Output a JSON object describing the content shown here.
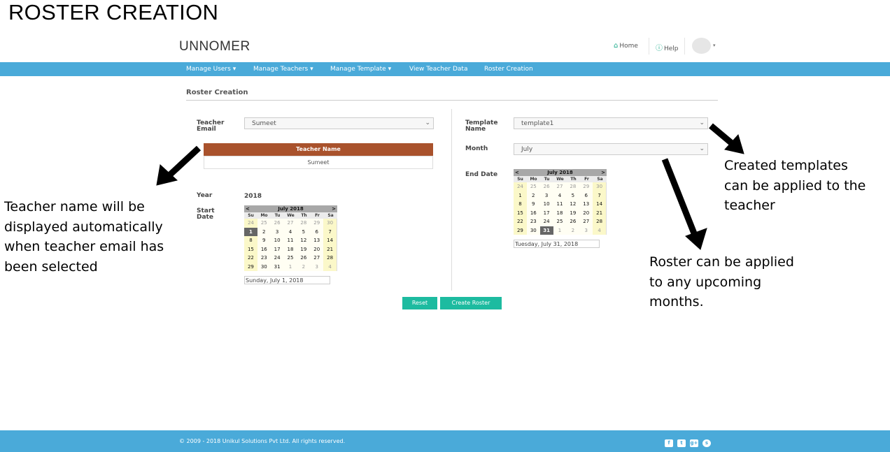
{
  "heading": "ROSTER CREATION",
  "header": {
    "brand": "UNNOMER",
    "home_label": "Home",
    "help_label": "Help"
  },
  "nav": {
    "items": [
      "Manage Users",
      "Manage Teachers",
      "Manage Template",
      "View Teacher Data",
      "Roster Creation"
    ]
  },
  "form": {
    "section_title": "Roster Creation",
    "teacher_email_label_1": "Teacher",
    "teacher_email_label_2": "Email",
    "teacher_email_value": "Sumeet",
    "teacher_name_header": "Teacher Name",
    "teacher_name_value": "Sumeet",
    "year_label": "Year",
    "year_value": "2018",
    "start_date_label_1": "Start",
    "start_date_label_2": "Date",
    "start_date_value": "Sunday, July 1, 2018",
    "template_label_1": "Template",
    "template_label_2": "Name",
    "template_value": "template1",
    "month_label": "Month",
    "month_value": "July",
    "end_date_label": "End Date",
    "end_date_value": "Tuesday, July 31, 2018",
    "reset_label": "Reset",
    "create_label": "Create Roster"
  },
  "calendar": {
    "title": "July 2018",
    "prev": "<",
    "next": ">",
    "weekdays": [
      "Su",
      "Mo",
      "Tu",
      "We",
      "Th",
      "Fr",
      "Sa"
    ],
    "days": [
      "24",
      "25",
      "26",
      "27",
      "28",
      "29",
      "30",
      "1",
      "2",
      "3",
      "4",
      "5",
      "6",
      "7",
      "8",
      "9",
      "10",
      "11",
      "12",
      "13",
      "14",
      "15",
      "16",
      "17",
      "18",
      "19",
      "20",
      "21",
      "22",
      "23",
      "24",
      "25",
      "26",
      "27",
      "28",
      "29",
      "30",
      "31",
      "1",
      "2",
      "3",
      "4"
    ],
    "start_selected": "1",
    "end_selected": "31"
  },
  "annotations": {
    "teacher_name": [
      "Teacher name will be",
      "displayed automatically",
      "when teacher email has",
      "been selected"
    ],
    "templates": [
      "Created templates",
      "can be applied to the",
      "teacher"
    ],
    "roster": [
      "Roster can be applied",
      "to any upcoming",
      "months."
    ]
  },
  "footer": {
    "copyright": "© 2009 - 2018 Unikul Solutions Pvt Ltd. All rights reserved.",
    "social_icons": [
      "facebook-icon",
      "twitter-icon",
      "google-plus-icon",
      "skype-icon"
    ]
  },
  "colors": {
    "nav_bar": "#4aaad9",
    "accent_button": "#1dbba0",
    "teacher_header": "#a9522c"
  }
}
